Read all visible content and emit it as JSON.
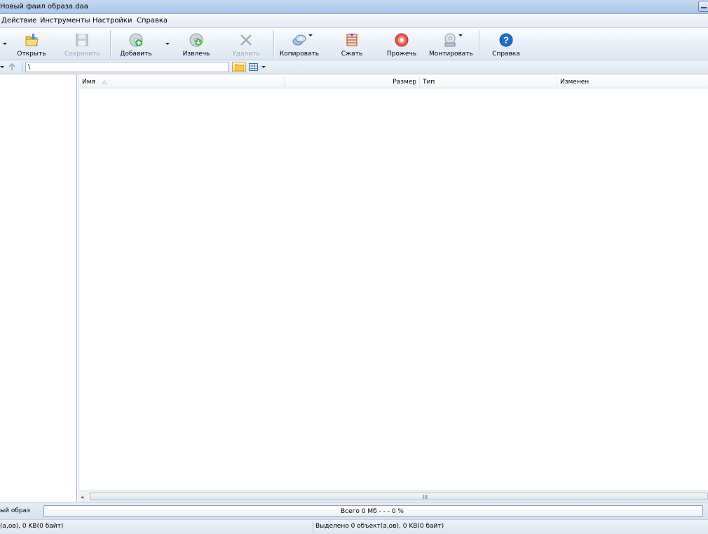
{
  "window": {
    "title": "Новый фаил образа.daa"
  },
  "menu": [
    "Действие",
    "Инструменты",
    "Настройки",
    "Справка"
  ],
  "toolbar": {
    "open": "Открыть",
    "save": "Сохранить",
    "add": "Добавить",
    "extract": "Извлечь",
    "delete": "Удалить",
    "copy": "Копировать",
    "compress": "Сжать",
    "burn": "Прожечь",
    "mount": "Монтировать",
    "help": "Справка"
  },
  "address": {
    "path": "\\"
  },
  "columns": {
    "name": "Имя",
    "size": "Размер",
    "type": "Тип",
    "modified": "Изменен"
  },
  "progress": {
    "label": "ый образ",
    "text": "Всего  0 Мб   - - -  0 %",
    "percent": 0
  },
  "status": {
    "left": "(а,ов), 0 KB(0 байт)",
    "right": "Выделено 0 объект(а,ов), 0 KB(0 байт)"
  },
  "colors": {
    "accent": "#1f6fc9",
    "progress_fill": "#5ec15b"
  }
}
